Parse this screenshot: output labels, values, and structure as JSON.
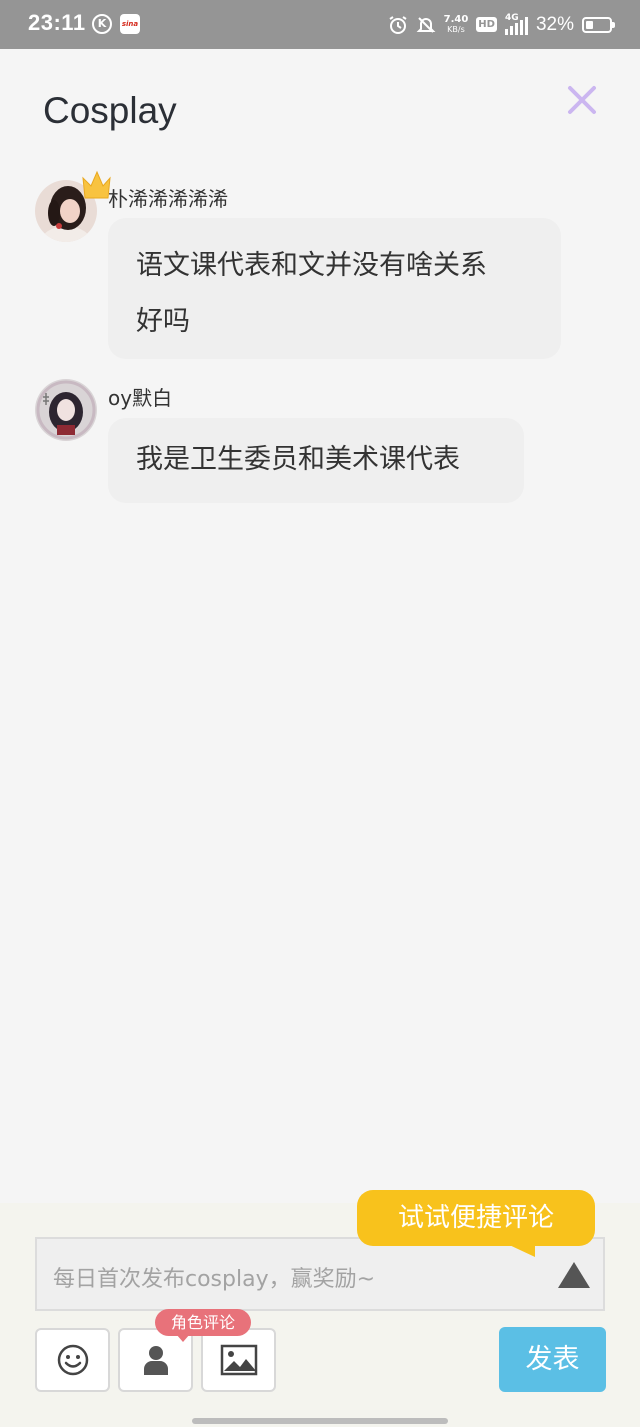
{
  "status_bar": {
    "time": "23:11",
    "app_icon_k": "K",
    "app_icon_sina": "sina",
    "speed_value": "7.40",
    "speed_unit": "KB/s",
    "hd": "HD",
    "network": "4G",
    "battery_pct": "32%"
  },
  "header": {
    "title": "Cosplay"
  },
  "comments": [
    {
      "user": "朴浠浠浠浠浠",
      "lines": [
        "语文课代表和文并没有啥关系",
        "好吗"
      ]
    },
    {
      "user": "oy默白",
      "lines": [
        "我是卫生委员和美术课代表"
      ]
    }
  ],
  "composer": {
    "tip": "试试便捷评论",
    "placeholder": "每日首次发布cosplay，赢奖励~",
    "role_badge": "角色评论",
    "send_label": "发表"
  },
  "colors": {
    "accent_send": "#5bbfe5",
    "tip_yellow": "#f8c21c",
    "badge_pink": "#e8727a",
    "close_purple": "#cbb6f0"
  }
}
